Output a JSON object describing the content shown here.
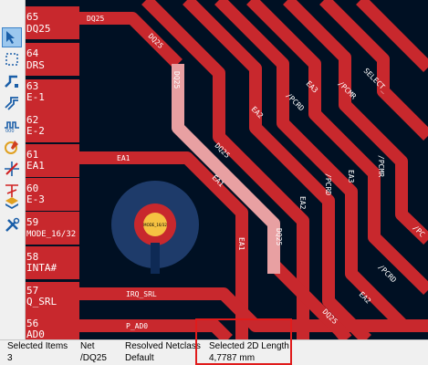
{
  "colors": {
    "board_bg": "#001023",
    "track_red": "#c8282d",
    "track_selected": "#e8a0a2",
    "pad_text": "#ffffff",
    "highlight_box": "#e01b1b",
    "via_ring": "#1e3b6a",
    "via_pad": "#c8282d",
    "via_inner": "#f5c242"
  },
  "toolbar": {
    "tools": [
      {
        "icon": "select-cursor-icon",
        "active": true
      },
      {
        "icon": "dashed-selection-icon",
        "active": false
      },
      {
        "icon": "route-track-icon",
        "active": false
      },
      {
        "icon": "differential-pair-icon",
        "active": false
      },
      {
        "icon": "tune-length-icon",
        "active": false
      },
      {
        "icon": "grid-origin-icon",
        "active": false
      },
      {
        "icon": "no-entry-icon",
        "active": false
      },
      {
        "icon": "crossed-lines-icon",
        "active": false
      },
      {
        "icon": "layer-stack-icon",
        "active": false
      },
      {
        "icon": "tools-icon",
        "active": false
      }
    ]
  },
  "pads": [
    {
      "number": "65",
      "net": "DQ25"
    },
    {
      "number": "64",
      "net": "DRS"
    },
    {
      "number": "63",
      "net": "E-1"
    },
    {
      "number": "62",
      "net": "E-2"
    },
    {
      "number": "61",
      "net": "EA1"
    },
    {
      "number": "60",
      "net": "E-3"
    },
    {
      "number": "59",
      "net": "MODE_16/32"
    },
    {
      "number": "58",
      "net": "INTA#"
    },
    {
      "number": "57",
      "net": "Q_SRL"
    },
    {
      "number": "56",
      "net": "AD0"
    }
  ],
  "track_labels": {
    "dq25_top": "DQ25",
    "dq25_diag1": "DQ25",
    "dq25_vert1": "DQ25",
    "dq25_diag2": "DQ25",
    "dq25_vert2": "DQ25",
    "ea1_horiz": "EA1",
    "ea1_diag": "EA1",
    "ea1_vert": "EA1",
    "ea2_a": "EA2",
    "ea2_b": "EA2",
    "ea2_c": "EA2",
    "pcrd_a": "/PCRD",
    "pcrd_b": "/PCRD",
    "pcrd_c": "/PCRD",
    "ea3_a": "EA3",
    "ea3_b": "EA3",
    "pcmr_a": "/PCMR",
    "pcmr_b": "/PCMR",
    "pcmr_c": "/PC",
    "select": "SELECT_",
    "irq_srl": "IRQ_SRL",
    "pad0": "P_AD0",
    "dq25_bottom": "DQ25"
  },
  "via": {
    "label": "MODE_16/32"
  },
  "statusbar": {
    "selected_items_label": "Selected Items",
    "selected_items_value": "3",
    "net_label": "Net",
    "net_value": "/DQ25",
    "netclass_label": "Resolved Netclass",
    "netclass_value": "Default",
    "length_label": "Selected 2D Length",
    "length_value": "4,7787 mm"
  }
}
